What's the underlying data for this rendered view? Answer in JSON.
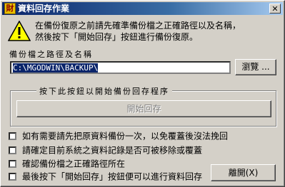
{
  "window": {
    "title": "資料回存作業",
    "app_icon_glyph": "財",
    "close_glyph": "✕"
  },
  "message": {
    "line1": "在備份復原之前請先確準備份檔之正確路徑以及名稱，",
    "line2": "然後按下「開始回存」按鈕進行備份復原。",
    "icon": "warning-icon"
  },
  "path": {
    "label": "備份檔之路徑及名稱",
    "value": "C:\\MGODWIN\\BACKUP\\",
    "browse_label": "瀏覽 ..."
  },
  "group": {
    "label": "按下此按鈕以開始備份回存程序",
    "start_label": "開始回存"
  },
  "checklist": [
    "如有需要請先把原資料備份一次，以免覆蓋後沒法挽回",
    "請確定目前系統之資料記錄是否可被移除或覆蓋",
    "確認備份檔之正確路徑所在",
    "最後按下「開始回存」按鈕便可以進行資料回存"
  ],
  "footer": {
    "close_label": "離開(X)"
  },
  "colors": {
    "title_bar": "#0a246a",
    "window_bg": "#d4d0c8",
    "selection": "#0a246a"
  }
}
